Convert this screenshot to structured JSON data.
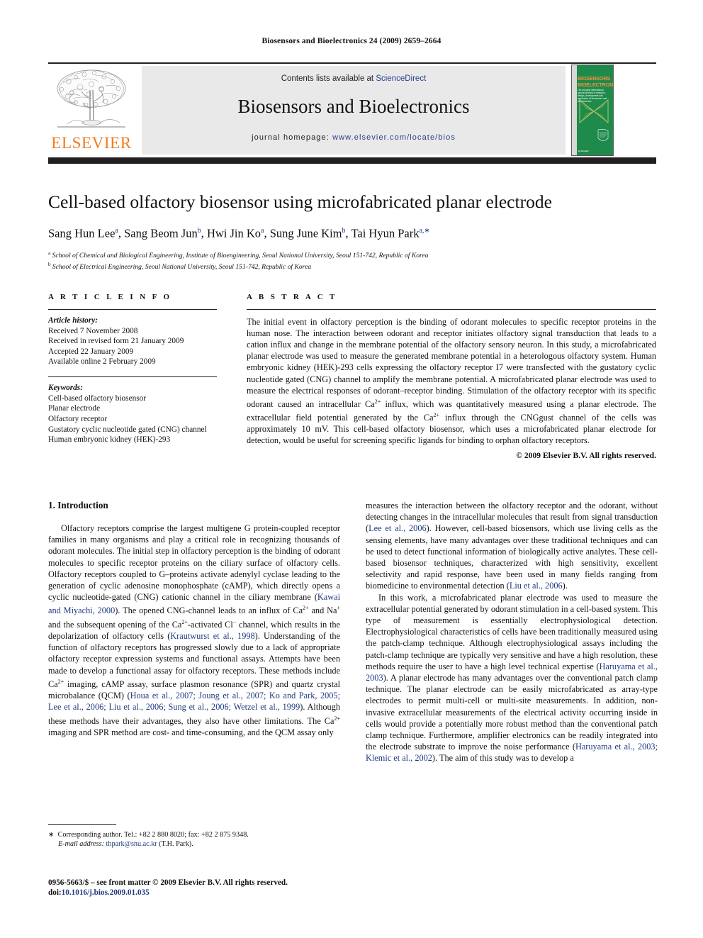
{
  "running_head": "Biosensors and Bioelectronics 24 (2009) 2659–2664",
  "masthead": {
    "contents_prefix": "Contents lists available at ",
    "sciencedirect": "ScienceDirect",
    "journal_title": "Biosensors and Bioelectronics",
    "homepage_label": "journal homepage:",
    "homepage_url": "www.elsevier.com/locate/bios",
    "elsevier_wordmark": "ELSEVIER",
    "cover": {
      "line1": "BIOSENSORS",
      "line2": "BIOELECTRONICS",
      "amp": "&",
      "subtitle": "The principal international journal devoted to research, design, development and application of biosensors and bioelectronics",
      "footer": "ELSEVIER"
    },
    "colors": {
      "elsevier_orange": "#f07c1f",
      "link_blue": "#2a3f8f",
      "panel_grey": "#e9e9e9",
      "cover_green": "#1e8a4c",
      "bar_black": "#231f20"
    }
  },
  "title": "Cell-based olfactory biosensor using microfabricated planar electrode",
  "authors": [
    {
      "name": "Sang Hun Lee",
      "sup": "a"
    },
    {
      "name": "Sang Beom Jun",
      "sup": "b"
    },
    {
      "name": "Hwi Jin Ko",
      "sup": "a"
    },
    {
      "name": "Sung June Kim",
      "sup": "b"
    },
    {
      "name": "Tai Hyun Park",
      "sup": "a,∗"
    }
  ],
  "affiliations": [
    {
      "marker": "a",
      "text": "School of Chemical and Biological Engineering, Institute of Bioengineering, Seoul National University, Seoul 151-742, Republic of Korea"
    },
    {
      "marker": "b",
      "text": "School of Electrical Engineering, Seoul National University, Seoul 151-742, Republic of Korea"
    }
  ],
  "article_info": {
    "heading": "A R T I C L E   I N F O",
    "history_label": "Article history:",
    "history": [
      "Received 7 November 2008",
      "Received in revised form 21 January 2009",
      "Accepted 22 January 2009",
      "Available online 2 February 2009"
    ],
    "keywords_label": "Keywords:",
    "keywords": [
      "Cell-based olfactory biosensor",
      "Planar electrode",
      "Olfactory receptor",
      "Gustatory cyclic nucleotide gated (CNG) channel",
      "Human embryonic kidney (HEK)-293"
    ]
  },
  "abstract": {
    "heading": "A B S T R A C T",
    "text_part1": "The initial event in olfactory perception is the binding of odorant molecules to specific receptor proteins in the human nose. The interaction between odorant and receptor initiates olfactory signal transduction that leads to a cation influx and change in the membrane potential of the olfactory sensory neuron. In this study, a microfabricated planar electrode was used to measure the generated membrane potential in a heterologous olfactory system. Human embryonic kidney (HEK)-293 cells expressing the olfactory receptor I7 were transfected with the gustatory cyclic nucleotide gated (CNG) channel to amplify the membrane potential. A microfabricated planar electrode was used to measure the electrical responses of odorant–receptor binding. Stimulation of the olfactory receptor with its specific odorant caused an intracellular Ca",
    "sup1": "2+",
    "text_part2": " influx, which was quantitatively measured using a planar electrode. The extracellular field potential generated by the Ca",
    "sup2": "2+",
    "text_part3": " influx through the CNGgust channel of the cells was approximately 10 mV. This cell-based olfactory biosensor, which uses a microfabricated planar electrode for detection, would be useful for screening specific ligands for binding to orphan olfactory receptors.",
    "copyright": "© 2009 Elsevier B.V. All rights reserved."
  },
  "intro": {
    "heading": "1. Introduction",
    "left_p1_a": "Olfactory receptors comprise the largest multigene G protein-coupled receptor families in many organisms and play a critical role in recognizing thousands of odorant molecules. The initial step in olfactory perception is the binding of odorant molecules to specific receptor proteins on the ciliary surface of olfactory cells. Olfactory receptors coupled to G–proteins activate adenylyl cyclase leading to the generation of cyclic adenosine monophosphate (cAMP), which directly opens a cyclic nucleotide-gated (CNG) cationic channel in the ciliary membrane (",
    "ref1": "Kawai and Miyachi, 2000",
    "left_p1_b": "). The opened CNG-channel leads to an influx of Ca",
    "sup_a": "2+",
    "left_p1_c": " and Na",
    "sup_b": "+",
    "left_p1_d": " and the subsequent opening of the Ca",
    "sup_c": "2+",
    "left_p1_e": "-activated Cl",
    "sup_d": "−",
    "left_p1_f": " channel, which results in the depolarization of olfactory cells (",
    "ref2": "Krautwurst et al., 1998",
    "left_p1_g": "). Understanding of the function of olfactory receptors has progressed slowly due to a lack of appropriate olfactory receptor expression systems and functional assays. Attempts have been made to develop a functional assay for olfactory receptors. These methods include Ca",
    "sup_e": "2+",
    "left_p1_h": " imaging, cAMP assay, surface plasmon resonance (SPR) and quartz crystal microbalance (QCM) (",
    "ref3": "Houa et al., 2007; Joung et al., 2007; Ko and Park, 2005; Lee et al., 2006; Liu et al., 2006; Sung et al., 2006; Wetzel et al., 1999",
    "left_p1_i": "). Although these methods have their advantages, they also have other limitations. The Ca",
    "sup_f": "2+",
    "left_p1_j": " imaging and SPR method are cost- and time-consuming, and the QCM assay only",
    "right_p1_a": "measures the interaction between the olfactory receptor and the odorant, without detecting changes in the intracellular molecules that result from signal transduction (",
    "ref4": "Lee et al., 2006",
    "right_p1_b": "). However, cell-based biosensors, which use living cells as the sensing elements, have many advantages over these traditional techniques and can be used to detect functional information of biologically active analytes. These cell-based biosensor techniques, characterized with high sensitivity, excellent selectivity and rapid response, have been used in many fields ranging from biomedicine to environmental detection (",
    "ref5": "Liu et al., 2006",
    "right_p1_c": ").",
    "right_p2_a": "In this work, a microfabricated planar electrode was used to measure the extracellular potential generated by odorant stimulation in a cell-based system. This type of measurement is essentially electrophysiological detection. Electrophysiological characteristics of cells have been traditionally measured using the patch-clamp technique. Although electrophysiological assays including the patch-clamp technique are typically very sensitive and have a high resolution, these methods require the user to have a high level technical expertise (",
    "ref6": "Haruyama et al., 2003",
    "right_p2_b": "). A planar electrode has many advantages over the conventional patch clamp technique. The planar electrode can be easily microfabricated as array-type electrodes to permit multi-cell or multi-site measurements. In addition, non-invasive extracellular measurements of the electrical activity occurring inside in cells would provide a potentially more robust method than the conventional patch clamp technique. Furthermore, amplifier electronics can be readily integrated into the electrode substrate to improve the noise performance (",
    "ref7": "Haruyama et al., 2003; Klemic et al., 2002",
    "right_p2_c": "). The aim of this study was to develop a"
  },
  "footnote": {
    "star": "∗",
    "corresponding": "Corresponding author. Tel.: +82 2 880 8020; fax: +82 2 875 9348.",
    "email_label": "E-mail address:",
    "email": "thpark@snu.ac.kr",
    "email_owner": "(T.H. Park)."
  },
  "imprint": {
    "line1": "0956-5663/$ – see front matter © 2009 Elsevier B.V. All rights reserved.",
    "doi_label": "doi:",
    "doi": "10.1016/j.bios.2009.01.035"
  }
}
